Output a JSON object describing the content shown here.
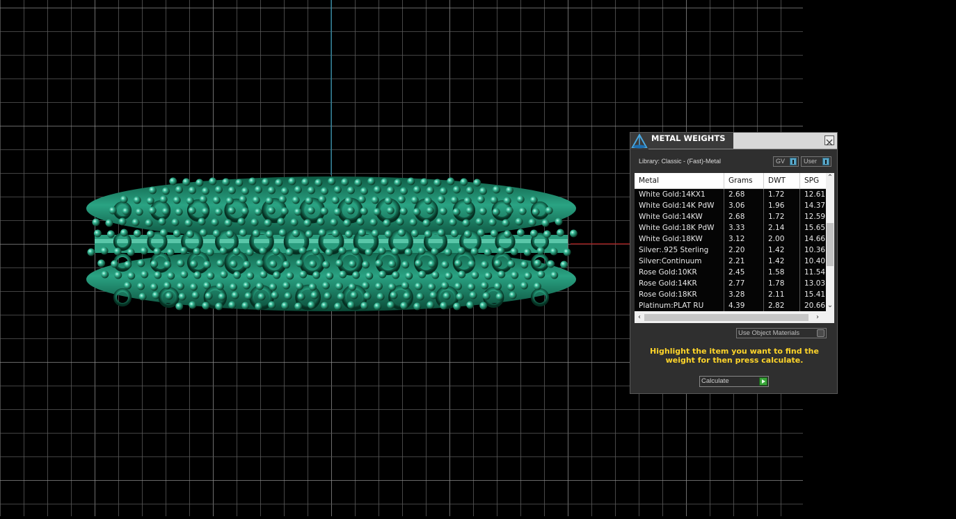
{
  "panel": {
    "title": "METAL WEIGHTS",
    "library": "Library: Classic - (Fast)-Metal",
    "gv_label": "GV",
    "user_label": "User",
    "columns": [
      "Metal",
      "Grams",
      "DWT",
      "SPG"
    ],
    "rows": [
      [
        "White Gold:14KX1",
        "2.68",
        "1.72",
        "12.61"
      ],
      [
        "White Gold:14K PdW",
        "3.06",
        "1.96",
        "14.37"
      ],
      [
        "White Gold:14KW",
        "2.68",
        "1.72",
        "12.59"
      ],
      [
        "White Gold:18K PdW",
        "3.33",
        "2.14",
        "15.65"
      ],
      [
        "White Gold:18KW",
        "3.12",
        "2.00",
        "14.66"
      ],
      [
        "Silver:.925 Sterling",
        "2.20",
        "1.42",
        "10.36"
      ],
      [
        "Silver:Continuum",
        "2.21",
        "1.42",
        "10.40"
      ],
      [
        "Rose Gold:10KR",
        "2.45",
        "1.58",
        "11.54"
      ],
      [
        "Rose Gold:14KR",
        "2.77",
        "1.78",
        "13.03"
      ],
      [
        "Rose Gold:18KR",
        "3.28",
        "2.11",
        "15.41"
      ],
      [
        "Platinum:PLAT RU",
        "4.39",
        "2.82",
        "20.66"
      ]
    ],
    "use_object_materials": "Use Object Materials",
    "instruction": "Highlight the item you want to find the weight for then press calculate.",
    "calculate": "Calculate"
  },
  "colors": {
    "grid": "#5a5a5a",
    "axis_blue": "#1e88a8",
    "axis_red": "#b01818",
    "model": "#1f8a6c",
    "instruction": "#ffd52a"
  },
  "icons": {
    "title_icon": "scale-triangle-icon",
    "close": "close-icon"
  }
}
